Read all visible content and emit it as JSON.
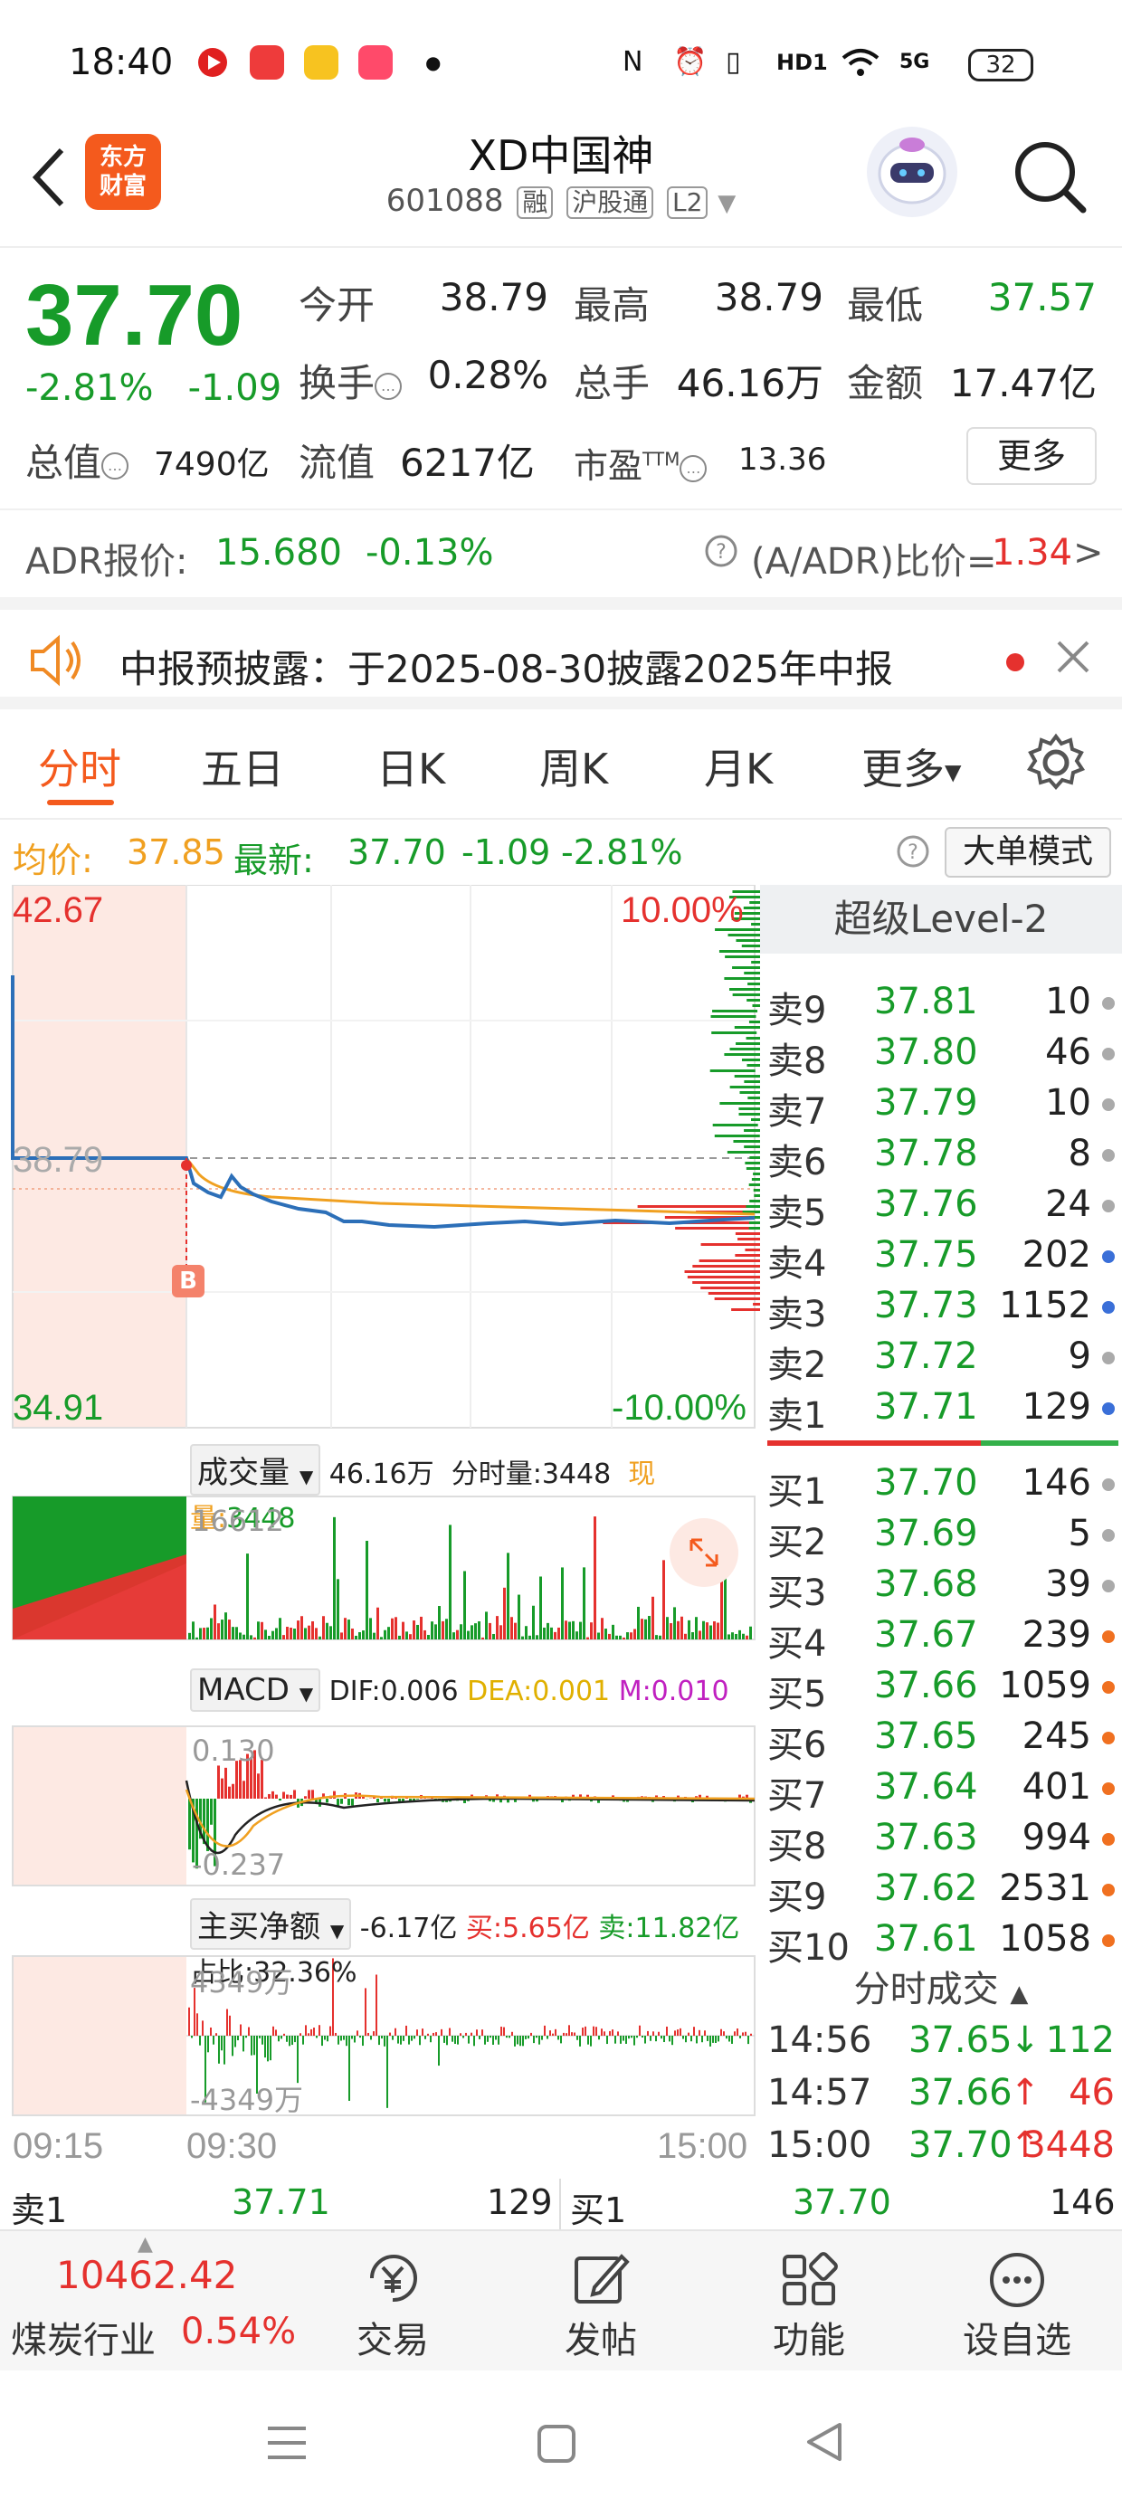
{
  "status_bar": {
    "time": "18:40",
    "battery": "32",
    "network": "5G",
    "hd_label": "HD1"
  },
  "header": {
    "logo_line1": "东方",
    "logo_line2": "财富",
    "title": "XD中国神",
    "code": "601088",
    "tags": [
      "融",
      "沪股通",
      "L2"
    ]
  },
  "quote": {
    "price": "37.70",
    "change_pct": "-2.81%",
    "change_abs": "-1.09",
    "rows": [
      {
        "label": "今开",
        "value": "38.79",
        "color": "dark"
      },
      {
        "label": "最高",
        "value": "38.79",
        "color": "dark"
      },
      {
        "label": "最低",
        "value": "37.57",
        "color": "green"
      },
      {
        "label": "换手",
        "value": "0.28%",
        "color": "dark"
      },
      {
        "label": "总手",
        "value": "46.16万",
        "color": "dark"
      },
      {
        "label": "金额",
        "value": "17.47亿",
        "color": "dark"
      }
    ],
    "total_value_label": "总值",
    "total_value": "7490亿",
    "float_value_label": "流值",
    "float_value": "6217亿",
    "pe_label": "市盈",
    "pe_sup": "TTM",
    "pe_value": "13.36",
    "more_label": "更多"
  },
  "adr": {
    "label": "ADR报价:",
    "price": "15.680",
    "change": "-0.13%",
    "ratio_label": "(A/ADR)比价=",
    "ratio_value": "1.34",
    "arrow": ">"
  },
  "notice": {
    "text": "中报预披露：于2025-08-30披露2025年中报"
  },
  "tabs": [
    "分时",
    "五日",
    "日K",
    "周K",
    "月K",
    "更多"
  ],
  "avg_line": {
    "avg_label": "均价:",
    "avg_value": "37.85",
    "latest_label": "最新:",
    "latest_value": "37.70",
    "latest_change": "-1.09",
    "latest_pct": "-2.81%",
    "big_order_btn": "大单模式"
  },
  "chart": {
    "price_high": "42.67",
    "price_low": "34.91",
    "pct_high": "10.00%",
    "pct_low": "-10.00%",
    "prev_close": "38.79",
    "marker": "B",
    "volume_label": "成交量",
    "volume_total": "46.16万",
    "volume_period": "分时量:3448",
    "volume_now": "现量:3448",
    "volume_max": "16612",
    "macd_label": "MACD",
    "dif": "DIF:0.006",
    "dea": "DEA:0.001",
    "m": "M:0.010",
    "macd_high": "0.130",
    "macd_low": "-0.237",
    "net_label": "主买净额",
    "net_value": "-6.17亿",
    "net_buy": "买:5.65亿",
    "net_sell": "卖:11.82亿",
    "net_ratio": "占比:32.36%",
    "net_high": "4349万",
    "net_low": "-4349万",
    "time_start": "09:15",
    "time_open": "09:30",
    "time_end": "15:00"
  },
  "chart_data": {
    "type": "line",
    "title": "",
    "xlabel": "",
    "ylabel": "",
    "x": [
      "09:15",
      "09:30",
      "15:00"
    ],
    "ylim": [
      34.91,
      42.67
    ],
    "series": [
      {
        "name": "",
        "values": [
          38.79,
          38.79,
          37.7
        ]
      },
      {
        "name": "均价",
        "values": [
          38.79,
          38.79,
          37.85
        ]
      }
    ]
  },
  "order_book": {
    "title": "超级Level-2",
    "asks": [
      {
        "label": "卖9",
        "price": "37.81",
        "vol": "10",
        "dot": "gray"
      },
      {
        "label": "卖8",
        "price": "37.80",
        "vol": "46",
        "dot": "gray"
      },
      {
        "label": "卖7",
        "price": "37.79",
        "vol": "10",
        "dot": "gray"
      },
      {
        "label": "卖6",
        "price": "37.78",
        "vol": "8",
        "dot": "gray"
      },
      {
        "label": "卖5",
        "price": "37.76",
        "vol": "24",
        "dot": "gray"
      },
      {
        "label": "卖4",
        "price": "37.75",
        "vol": "202",
        "dot": "blue"
      },
      {
        "label": "卖3",
        "price": "37.73",
        "vol": "1152",
        "dot": "blue"
      },
      {
        "label": "卖2",
        "price": "37.72",
        "vol": "9",
        "dot": "gray"
      },
      {
        "label": "卖1",
        "price": "37.71",
        "vol": "129",
        "dot": "blue"
      }
    ],
    "bids": [
      {
        "label": "买1",
        "price": "37.70",
        "vol": "146",
        "dot": "gray"
      },
      {
        "label": "买2",
        "price": "37.69",
        "vol": "5",
        "dot": "gray"
      },
      {
        "label": "买3",
        "price": "37.68",
        "vol": "39",
        "dot": "gray"
      },
      {
        "label": "买4",
        "price": "37.67",
        "vol": "239",
        "dot": "orange"
      },
      {
        "label": "买5",
        "price": "37.66",
        "vol": "1059",
        "dot": "orange"
      },
      {
        "label": "买6",
        "price": "37.65",
        "vol": "245",
        "dot": "orange"
      },
      {
        "label": "买7",
        "price": "37.64",
        "vol": "401",
        "dot": "orange"
      },
      {
        "label": "买8",
        "price": "37.63",
        "vol": "994",
        "dot": "orange"
      },
      {
        "label": "买9",
        "price": "37.62",
        "vol": "2531",
        "dot": "orange"
      },
      {
        "label": "买10",
        "price": "37.61",
        "vol": "1058",
        "dot": "orange"
      }
    ],
    "trades_title": "分时成交",
    "trades": [
      {
        "time": "14:56",
        "price": "37.65",
        "dir": "↓",
        "vol": "112",
        "color": "green"
      },
      {
        "time": "14:57",
        "price": "37.66",
        "dir": "↑",
        "vol": "46",
        "color": "red"
      },
      {
        "time": "15:00",
        "price": "37.70",
        "dir": "↑",
        "vol": "3448",
        "color": "red"
      }
    ]
  },
  "book_line": {
    "ask_label": "卖1",
    "ask_price": "37.71",
    "ask_vol": "129",
    "bid_label": "买1",
    "bid_price": "37.70",
    "bid_vol": "146"
  },
  "bottom_nav": {
    "index_value": "10462.42",
    "index_name": "煤炭行业",
    "index_pct": "0.54%",
    "items": [
      {
        "label": "交易",
        "icon": "yen-cycle-icon"
      },
      {
        "label": "发帖",
        "icon": "edit-icon"
      },
      {
        "label": "功能",
        "icon": "grid-icon"
      },
      {
        "label": "设自选",
        "icon": "more-icon"
      }
    ]
  },
  "colors": {
    "up": "#e5312e",
    "down": "#179b29",
    "brand": "#f45a1d",
    "avg": "#f0a020",
    "price_line": "#2c6fb8"
  }
}
